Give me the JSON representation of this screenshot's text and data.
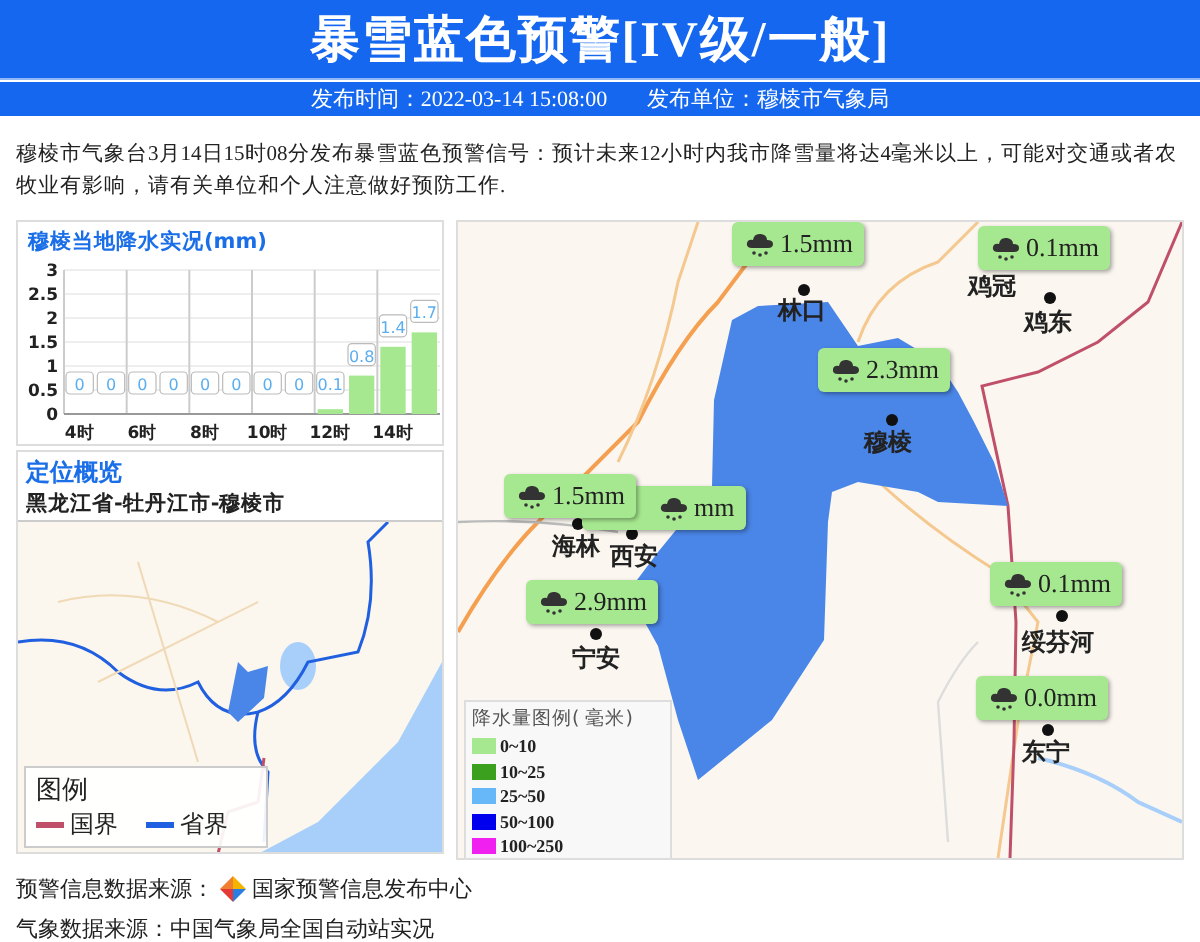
{
  "header": {
    "title": "暴雪蓝色预警[IV级/一般]",
    "publish_time": "发布时间：2022-03-14 15:08:00",
    "publisher": "发布单位：穆棱市气象局"
  },
  "message": "穆棱市气象台3月14日15时08分发布暴雪蓝色预警信号：预计未来12小时内我市降雪量将达4毫米以上，可能对交通或者农牧业有影响，请有关单位和个人注意做好预防工作.",
  "rain_panel": {
    "title": "穆棱当地降水实况(mm)",
    "chart_data": {
      "type": "bar",
      "x": [
        4,
        5,
        6,
        7,
        8,
        9,
        10,
        11,
        12,
        13,
        14,
        15
      ],
      "values": [
        0,
        0,
        0,
        0,
        0,
        0,
        0,
        0,
        0.1,
        0.8,
        1.4,
        1.7
      ],
      "value_labels": [
        "0",
        "0",
        "0",
        "0",
        "0",
        "0",
        "0",
        "0",
        "0.1",
        "0.8",
        "1.4",
        "1.7"
      ],
      "ylim": [
        0,
        3
      ],
      "xlim": [
        3.5,
        15.5
      ],
      "grid": true,
      "yticks": [
        {
          "value": 0,
          "label": "0"
        },
        {
          "value": 0.5,
          "label": "0.5"
        },
        {
          "value": 1,
          "label": "1"
        },
        {
          "value": 1.5,
          "label": "1.5"
        },
        {
          "value": 2,
          "label": "2"
        },
        {
          "value": 2.5,
          "label": "2.5"
        },
        {
          "value": 3,
          "label": "3"
        }
      ],
      "xticks": [
        {
          "value": 4,
          "label": "4时"
        },
        {
          "value": 6,
          "label": "6时"
        },
        {
          "value": 8,
          "label": "8时"
        },
        {
          "value": 10,
          "label": "10时"
        },
        {
          "value": 12,
          "label": "12时"
        },
        {
          "value": 14,
          "label": "14时"
        }
      ]
    }
  },
  "location_panel": {
    "title": "定位概览",
    "path": "黑龙江省-牡丹江市-穆棱市",
    "legend": {
      "title": "图例",
      "items": [
        {
          "label": "国界",
          "color": "#c0506a"
        },
        {
          "label": "省界",
          "color": "#2060e0"
        }
      ]
    }
  },
  "map": {
    "markers": [
      {
        "value": "1.5mm"
      },
      {
        "value": "0.1mm"
      },
      {
        "value": "2.3mm"
      },
      {
        "value": "mm"
      },
      {
        "value": "1.5mm"
      },
      {
        "value": "2.9mm"
      },
      {
        "value": "0.1mm"
      },
      {
        "value": "0.0mm"
      }
    ],
    "cities": [
      {
        "name": "林口"
      },
      {
        "name": "鸡冠"
      },
      {
        "name": "鸡东"
      },
      {
        "name": "穆棱"
      },
      {
        "name": "海林"
      },
      {
        "name": "西安"
      },
      {
        "name": "宁安"
      },
      {
        "name": "绥芬河"
      },
      {
        "name": "东宁"
      }
    ],
    "legend": {
      "title": "降水量图例( 毫米)",
      "items": [
        {
          "label": "0~10",
          "color": "#a6e88f"
        },
        {
          "label": "10~25",
          "color": "#3aa01e"
        },
        {
          "label": "25~50",
          "color": "#66b8f8"
        },
        {
          "label": "50~100",
          "color": "#0000ee"
        },
        {
          "label": "100~250",
          "color": "#f020f0"
        }
      ]
    }
  },
  "footer": {
    "warning_source_label": "预警信息数据来源：",
    "warning_source": "国家预警信息发布中心",
    "weather_source": "气象数据来源：中国气象局全国自动站实况"
  }
}
